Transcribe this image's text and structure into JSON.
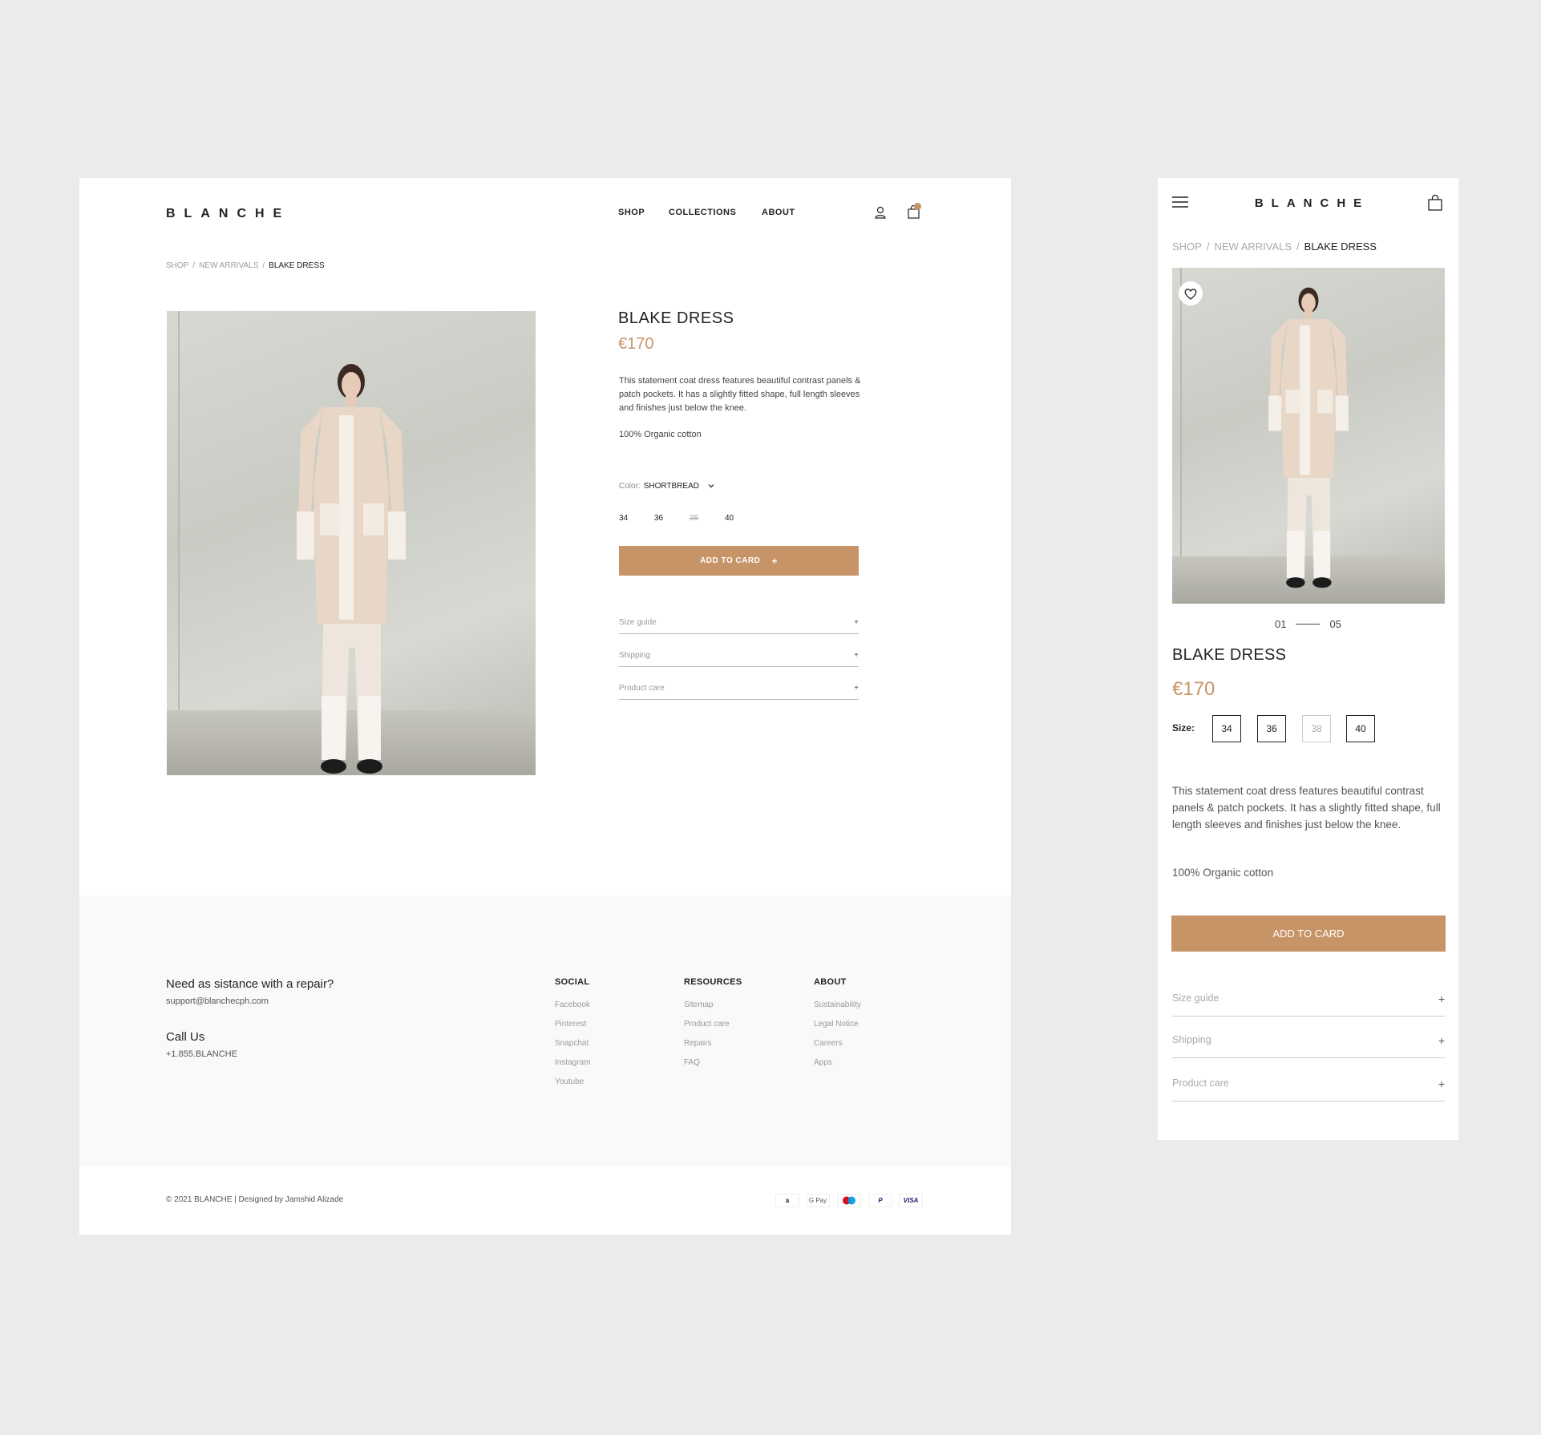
{
  "brand": "BLANCHE",
  "accent_color": "#c79468",
  "nav": {
    "shop": "SHOP",
    "collections": "COLLECTIONS",
    "about": "ABOUT"
  },
  "breadcrumb": {
    "shop": "SHOP",
    "sep": "/",
    "new_arrivals": "NEW ARRIVALS",
    "current": "BLAKE DRESS"
  },
  "product": {
    "title": "BLAKE DRESS",
    "price": "€170",
    "description": "This statement coat dress features beautiful contrast panels & patch pockets. It has a slightly fitted shape, full length sleeves and finishes just below the knee.",
    "material": "100% Organic cotton",
    "color_label": "Color:",
    "color_value": "SHORTBREAD",
    "sizes": [
      "34",
      "36",
      "38",
      "40"
    ],
    "unavailable_size": "38",
    "size_label": "Size:",
    "add_to_cart": "ADD TO CARD",
    "add_plus": "+",
    "accordion": [
      "Size guide",
      "Shipping",
      "Product care"
    ],
    "accordion_plus": "+",
    "pager": {
      "current": "01",
      "total": "05"
    }
  },
  "footer": {
    "repair_heading": "Need as sistance with a repair?",
    "repair_email": "support@blanchecph.com",
    "call_heading": "Call Us",
    "call_number": "+1.855.BLANCHE",
    "columns": [
      {
        "heading": "SOCIAL",
        "items": [
          "Facebook",
          "Pinterest",
          "Snapchat",
          "Instagram",
          "Youtube"
        ]
      },
      {
        "heading": "RESOURCES",
        "items": [
          "Sitemap",
          "Product care",
          "Repairs",
          "FAQ"
        ]
      },
      {
        "heading": "ABOUT",
        "items": [
          "Sustainability",
          "Legal Notice",
          "Careers",
          "Apps"
        ]
      }
    ],
    "copyright": "© 2021 BLANCHE | Designed by Jamshid Alizade",
    "payments": [
      "a",
      "G Pay",
      "",
      "P",
      "VISA"
    ]
  },
  "icons": {
    "user": "user-icon",
    "cart": "shopping-bag-icon",
    "menu": "hamburger-menu-icon",
    "heart": "heart-icon",
    "chevron": "chevron-down-icon"
  }
}
